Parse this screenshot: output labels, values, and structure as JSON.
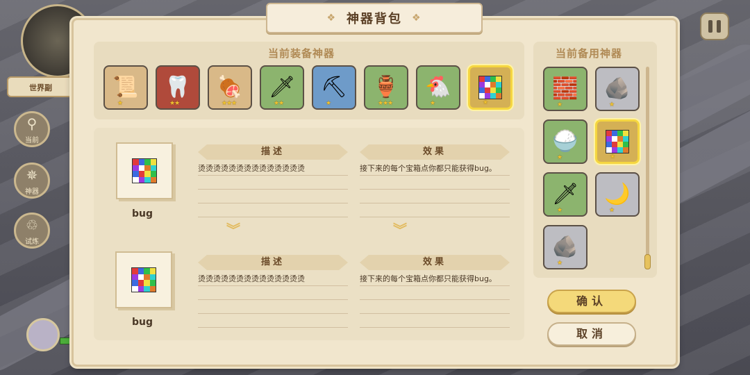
{
  "hud": {
    "world_button_label": "世界副",
    "side_buttons": [
      {
        "label": "当前",
        "icon": "map-pin-icon"
      },
      {
        "label": "神器",
        "icon": "artifact-icon"
      },
      {
        "label": "试炼",
        "icon": "trial-icon"
      }
    ],
    "pause_icon": "pause-icon"
  },
  "dialog": {
    "title": "神器背包",
    "equipped_title": "当前装备神器",
    "backup_title": "当前备用神器",
    "equipped_slots": [
      {
        "icon": "scroll-icon",
        "stars": 1,
        "rarity_color": "#d9b988"
      },
      {
        "icon": "teeth-icon",
        "stars": 2,
        "rarity_color": "#b04a3b"
      },
      {
        "icon": "meat-icon",
        "stars": 3,
        "rarity_color": "#d9b988"
      },
      {
        "icon": "dagger-icon",
        "stars": 2,
        "rarity_color": "#8cb46e"
      },
      {
        "icon": "pickaxe-icon",
        "stars": 1,
        "rarity_color": "#6e9bc9"
      },
      {
        "icon": "vase-icon",
        "stars": 3,
        "rarity_color": "#8cb46e"
      },
      {
        "icon": "chicken-icon",
        "stars": 1,
        "rarity_color": "#8cb46e"
      },
      {
        "icon": "bug-icon",
        "stars": 1,
        "rarity_color": "#d4b055",
        "selected": true
      }
    ],
    "backup_slots": [
      {
        "icon": "brick-icon",
        "stars": 1,
        "rarity_color": "#8cb46e"
      },
      {
        "icon": "rock-icon",
        "stars": 1,
        "rarity_color": "#bdbdc2"
      },
      {
        "icon": "rice-bowl-icon",
        "stars": 1,
        "rarity_color": "#8cb46e"
      },
      {
        "icon": "bug-icon",
        "stars": 1,
        "rarity_color": "#d4b055",
        "selected": true
      },
      {
        "icon": "dagger-icon",
        "stars": 1,
        "rarity_color": "#8cb46e"
      },
      {
        "icon": "blade-icon",
        "stars": 1,
        "rarity_color": "#bdbdc2"
      },
      {
        "icon": "rock-icon",
        "stars": 1,
        "rarity_color": "#bdbdc2"
      }
    ],
    "current": {
      "name": "bug",
      "desc_head": "描述",
      "desc_text": "烫烫烫烫烫烫烫烫烫烫烫烫烫烫",
      "effect_head": "效果",
      "effect_text": "接下来的每个宝箱点你都只能获得bug。"
    },
    "replacement": {
      "name": "bug",
      "desc_head": "描述",
      "desc_text": "烫烫烫烫烫烫烫烫烫烫烫烫烫烫",
      "effect_head": "效果",
      "effect_text": "接下来的每个宝箱点你都只能获得bug。"
    },
    "confirm_label": "确认",
    "cancel_label": "取消"
  }
}
